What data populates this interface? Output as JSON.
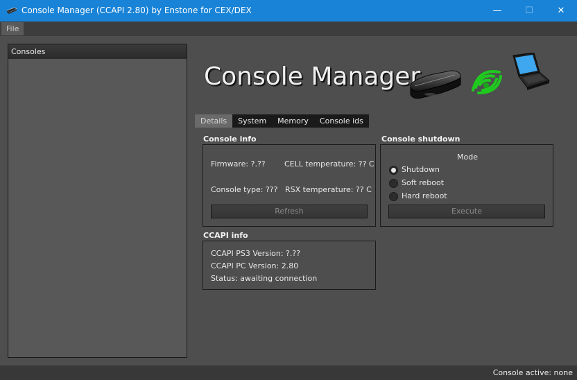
{
  "window": {
    "title": "Console Manager (CCAPI 2.80) by Enstone for CEX/DEX",
    "minimize_glyph": "—",
    "maximize_glyph": "☐",
    "close_glyph": "✕",
    "titlebar_color": "#1883d7"
  },
  "menu": {
    "file": "File"
  },
  "consoles_panel": {
    "header": "Consoles"
  },
  "logo": {
    "text": "Console Manager",
    "icons": [
      "ps3-console-icon",
      "wireless-signal-icon",
      "laptop-icon"
    ]
  },
  "tabs": [
    {
      "label": "Details",
      "active": true
    },
    {
      "label": "System",
      "active": false
    },
    {
      "label": "Memory",
      "active": false
    },
    {
      "label": "Console ids",
      "active": false
    }
  ],
  "console_info": {
    "title": "Console info",
    "firmware": "Firmware: ?.??",
    "cell_temp": "CELL temperature: ?? C",
    "console_type": "Console type: ???",
    "rsx_temp": "RSX temperature: ?? C",
    "refresh_label": "Refresh"
  },
  "console_shutdown": {
    "title": "Console shutdown",
    "mode_label": "Mode",
    "options": [
      {
        "label": "Shutdown",
        "checked": true
      },
      {
        "label": "Soft reboot",
        "checked": false
      },
      {
        "label": "Hard reboot",
        "checked": false
      }
    ],
    "execute_label": "Execute"
  },
  "ccapi_info": {
    "title": "CCAPI info",
    "ps3_version": "CCAPI PS3 Version: ?.??",
    "pc_version": "CCAPI PC Version: 2.80",
    "status": "Status: awaiting connection"
  },
  "statusbar": {
    "text": "Console active: none"
  }
}
